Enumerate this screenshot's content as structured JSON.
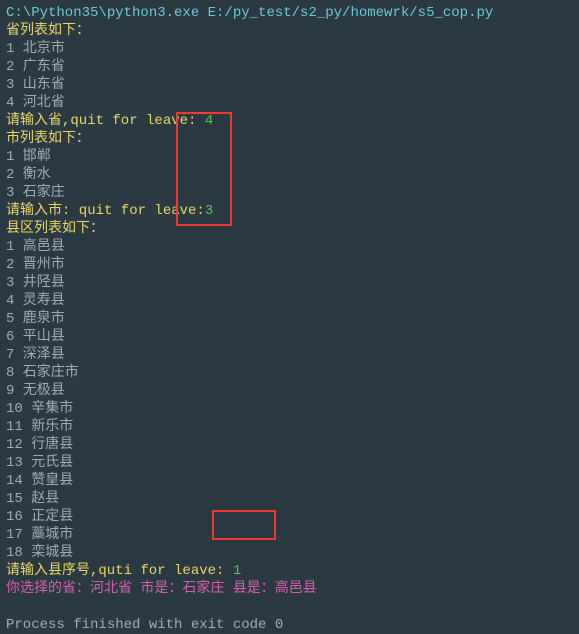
{
  "exec_path": "C:\\Python35\\python3.exe E:/py_test/s2_py/homewrk/s5_cop.py",
  "province": {
    "header": "省列表如下：",
    "items": [
      "1 北京市",
      "2 广东省",
      "3 山东省",
      "4 河北省"
    ],
    "prompt": "请输入省,quit for leave: ",
    "input": "4"
  },
  "city": {
    "header": "市列表如下：",
    "items": [
      "1 邯郸",
      "2 衡水",
      "3 石家庄"
    ],
    "prompt": "请输入市: quit for leave:",
    "input": "3"
  },
  "county": {
    "header": "县区列表如下：",
    "items": [
      "1 高邑县",
      "2 晋州市",
      "3 井陉县",
      "4 灵寿县",
      "5 鹿泉市",
      "6 平山县",
      "7 深泽县",
      "8 石家庄市",
      "9 无极县",
      "10 辛集市",
      "11 新乐市",
      "12 行唐县",
      "13 元氏县",
      "14 赞皇县",
      "15 赵县",
      "16 正定县",
      "17 藁城市",
      "18 栾城县"
    ],
    "prompt": "请输入县序号,quti for leave: ",
    "input": "1"
  },
  "result": "你选择的省：河北省 市是：石家庄 县是：高邑县",
  "exit_msg": "Process finished with exit code 0"
}
